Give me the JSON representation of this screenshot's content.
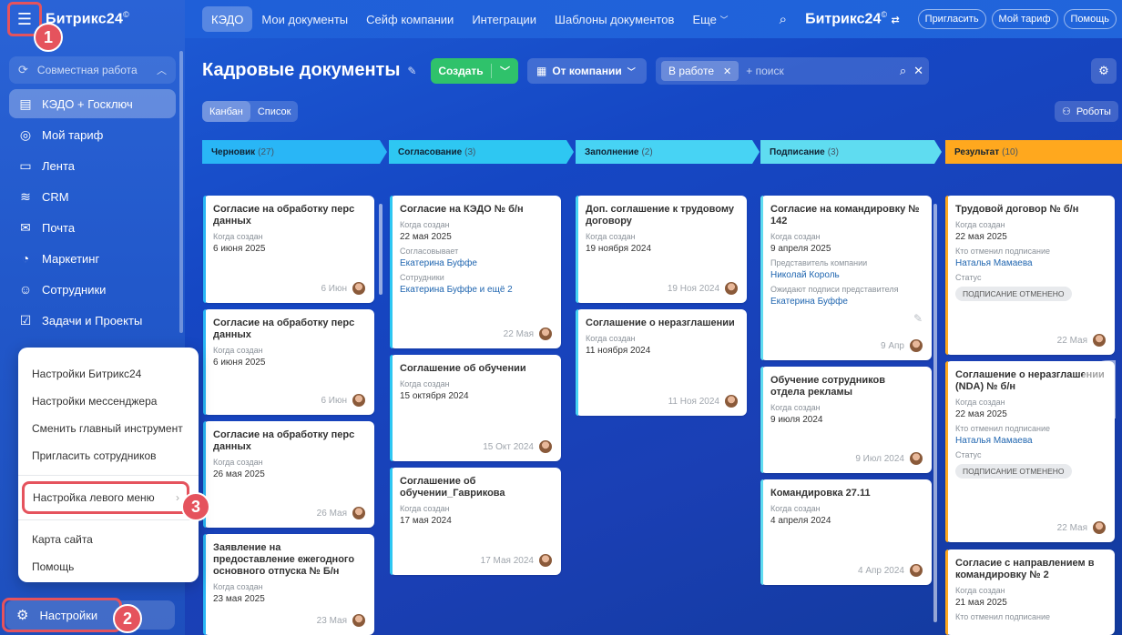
{
  "app": {
    "logo": "Битрикс24",
    "logo_mark": "©"
  },
  "topbar": {
    "tabs": [
      "КЭДО",
      "Мои документы",
      "Сейф компании",
      "Интеграции",
      "Шаблоны документов",
      "Еще"
    ],
    "logo": "Битрикс24",
    "invite": "Пригласить",
    "plan": "Мой тариф",
    "help": "Помощь"
  },
  "sidebar": {
    "group": "Совместная работа",
    "items": [
      "КЭДО + Госключ",
      "Мой тариф",
      "Лента",
      "CRM",
      "Почта",
      "Маркетинг",
      "Сотрудники",
      "Задачи и Проекты"
    ],
    "settings": "Настройки"
  },
  "popup": {
    "items": [
      "Настройки Битрикс24",
      "Настройки мессенджера",
      "Сменить главный инструмент",
      "Пригласить сотрудников"
    ],
    "highlighted": "Настройка левого меню",
    "bottom": [
      "Карта сайта",
      "Помощь"
    ]
  },
  "badges": [
    "1",
    "2",
    "3"
  ],
  "toolbar": {
    "title": "Кадровые документы",
    "create": "Создать",
    "company": "От компании",
    "filter_chip": "В работе",
    "search_placeholder": "+ поиск",
    "view_kanban": "Канбан",
    "view_list": "Список",
    "robots": "Роботы"
  },
  "columns": [
    {
      "name": "Черновик",
      "count": "(27)",
      "color": "#29b6f6"
    },
    {
      "name": "Согласование",
      "count": "(3)",
      "color": "#2ec7f2"
    },
    {
      "name": "Заполнение",
      "count": "(2)",
      "color": "#47d3f4"
    },
    {
      "name": "Подписание",
      "count": "(3)",
      "color": "#5fdcf0"
    },
    {
      "name": "Результат",
      "count": "(10)",
      "color": "#ffa81e"
    }
  ],
  "cards": {
    "c1": {
      "title": "Согласие на обработку перс данных",
      "l1": "Когда создан",
      "v1": "6 июня 2025",
      "date": "6 Июн"
    },
    "c2": {
      "title": "Согласие на обработку перс данных",
      "l1": "Когда создан",
      "v1": "6 июня 2025",
      "date": "6 Июн"
    },
    "c3": {
      "title": "Согласие на обработку перс данных",
      "l1": "Когда создан",
      "v1": "26 мая 2025",
      "date": "26 Мая"
    },
    "c4": {
      "title": "Заявление на предоставление ежегодного основного отпуска № Б/н",
      "l1": "Когда создан",
      "v1": "23 мая 2025",
      "date": "23 Мая"
    },
    "s1": {
      "title": "Согласие на КЭДО № б/н",
      "l1": "Когда создан",
      "v1": "22 мая 2025",
      "l2": "Согласовывает",
      "v2": "Екатерина Буффе",
      "l3": "Сотрудники",
      "v3": "Екатерина Буффе и ещё 2",
      "date": "22 Мая"
    },
    "s2": {
      "title": "Соглашение об обучении",
      "l1": "Когда создан",
      "v1": "15 октября 2024",
      "date": "15 Окт 2024"
    },
    "s3": {
      "title": "Соглашение об обучении_Гаврикова",
      "l1": "Когда создан",
      "v1": "17 мая 2024",
      "date": "17 Мая 2024"
    },
    "f1": {
      "title": "Доп. соглашение к трудовому договору",
      "l1": "Когда создан",
      "v1": "19 ноября 2024",
      "date": "19 Ноя 2024"
    },
    "f2": {
      "title": "Соглашение о неразглашении",
      "l1": "Когда создан",
      "v1": "11 ноября 2024",
      "date": "11 Ноя 2024"
    },
    "p1": {
      "title": "Согласие на командировку № 142",
      "l1": "Когда создан",
      "v1": "9 апреля 2025",
      "l2": "Представитель компании",
      "v2": "Николай Король",
      "l3": "Ожидают подписи представителя",
      "v3": "Екатерина Буффе",
      "date": "9 Апр"
    },
    "p2": {
      "title": "Обучение сотрудников отдела рекламы",
      "l1": "Когда создан",
      "v1": "9 июля 2024",
      "date": "9 Июл 2024"
    },
    "p3": {
      "title": "Командировка 27.11",
      "l1": "Когда создан",
      "v1": "4 апреля 2024",
      "date": "4 Апр 2024"
    },
    "r1": {
      "title": "Трудовой договор № б/н",
      "l1": "Когда создан",
      "v1": "22 мая 2025",
      "l2": "Кто отменил подписание",
      "v2": "Наталья Мамаева",
      "l3": "Статус",
      "status": "ПОДПИСАНИЕ ОТМЕНЕНО",
      "date": "22 Мая"
    },
    "r2": {
      "title": "Соглашение о неразглашении (NDA) № б/н",
      "l1": "Когда создан",
      "v1": "22 мая 2025",
      "l2": "Кто отменил подписание",
      "v2": "Наталья Мамаева",
      "l3": "Статус",
      "status": "ПОДПИСАНИЕ ОТМЕНЕНО",
      "date": "22 Мая"
    },
    "r3": {
      "title": "Согласие с направлением в командировку № 2",
      "l1": "Когда создан",
      "v1": "21 мая 2025",
      "l2": "Кто отменил подписание"
    }
  }
}
